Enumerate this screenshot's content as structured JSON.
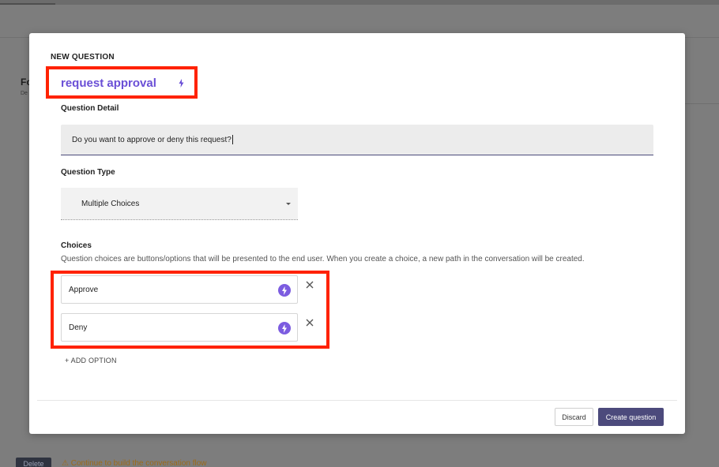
{
  "background": {
    "title": "Fo",
    "subtitle": "De",
    "delete_label": "Delete",
    "warning_text": "⚠ Continue to build the conversation flow"
  },
  "modal": {
    "heading": "NEW QUESTION",
    "question_name": "request approval",
    "question_detail_label": "Question Detail",
    "question_detail_value": "Do you want to approve or deny this request?",
    "question_type_label": "Question Type",
    "question_type_value": "Multiple Choices",
    "choices_label": "Choices",
    "choices_help": "Question choices are buttons/options that will be presented to the end user. When you create a choice, a new path in the conversation will be created.",
    "choices": [
      {
        "label": "Approve"
      },
      {
        "label": "Deny"
      }
    ],
    "add_option_label": "+ ADD OPTION",
    "discard_label": "Discard",
    "create_label": "Create question"
  },
  "icons": {
    "title_icon": "bolt-icon",
    "choice_icon": "bolt-circle-icon",
    "remove_icon": "close-icon",
    "dropdown_icon": "caret-down-icon"
  },
  "colors": {
    "accent": "#6a4fd6",
    "primary_button": "#4c4a7c",
    "annotation": "#ff2200"
  }
}
